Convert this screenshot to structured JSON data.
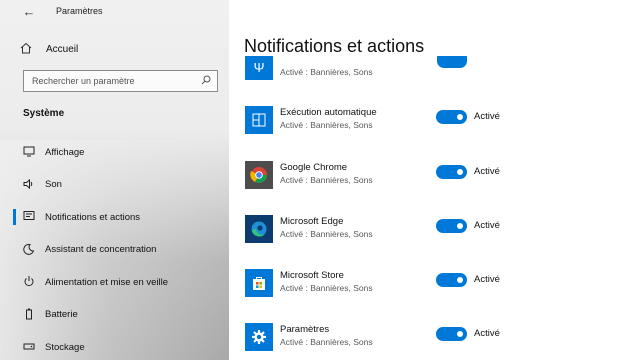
{
  "window": {
    "title": "Paramètres"
  },
  "sidebar": {
    "home_label": "Accueil",
    "search_placeholder": "Rechercher un paramètre",
    "section_title": "Système",
    "items": [
      {
        "label": "Affichage",
        "icon": "display-icon"
      },
      {
        "label": "Son",
        "icon": "speaker-icon"
      },
      {
        "label": "Notifications et actions",
        "icon": "notifications-icon",
        "active": true
      },
      {
        "label": "Assistant de concentration",
        "icon": "moon-icon"
      },
      {
        "label": "Alimentation et mise en veille",
        "icon": "power-icon"
      },
      {
        "label": "Batterie",
        "icon": "battery-icon"
      },
      {
        "label": "Stockage",
        "icon": "storage-icon"
      }
    ]
  },
  "main": {
    "title": "Notifications et actions",
    "partial_row": {
      "subtitle": "Activé : Bannières, Sons",
      "toggle_on": true
    },
    "apps": [
      {
        "name": "Exécution automatique",
        "subtitle": "Activé : Bannières, Sons",
        "toggle_label": "Activé",
        "toggle_on": true,
        "icon": "autoplay-icon",
        "icon_color": "#0078d7"
      },
      {
        "name": "Google Chrome",
        "subtitle": "Activé : Bannières, Sons",
        "toggle_label": "Activé",
        "toggle_on": true,
        "icon": "chrome-icon",
        "icon_color": "#4d4d4d"
      },
      {
        "name": "Microsoft Edge",
        "subtitle": "Activé : Bannières, Sons",
        "toggle_label": "Activé",
        "toggle_on": true,
        "icon": "edge-icon",
        "icon_color": "#0c3b70"
      },
      {
        "name": "Microsoft Store",
        "subtitle": "Activé : Bannières, Sons",
        "toggle_label": "Activé",
        "toggle_on": true,
        "icon": "store-icon",
        "icon_color": "#0078d7"
      },
      {
        "name": "Paramètres",
        "subtitle": "Activé : Bannières, Sons",
        "toggle_label": "Activé",
        "toggle_on": true,
        "icon": "settings-gear-icon",
        "icon_color": "#0078d7"
      }
    ]
  },
  "colors": {
    "accent": "#0078d7",
    "secondary_text": "#5a5a5a"
  }
}
